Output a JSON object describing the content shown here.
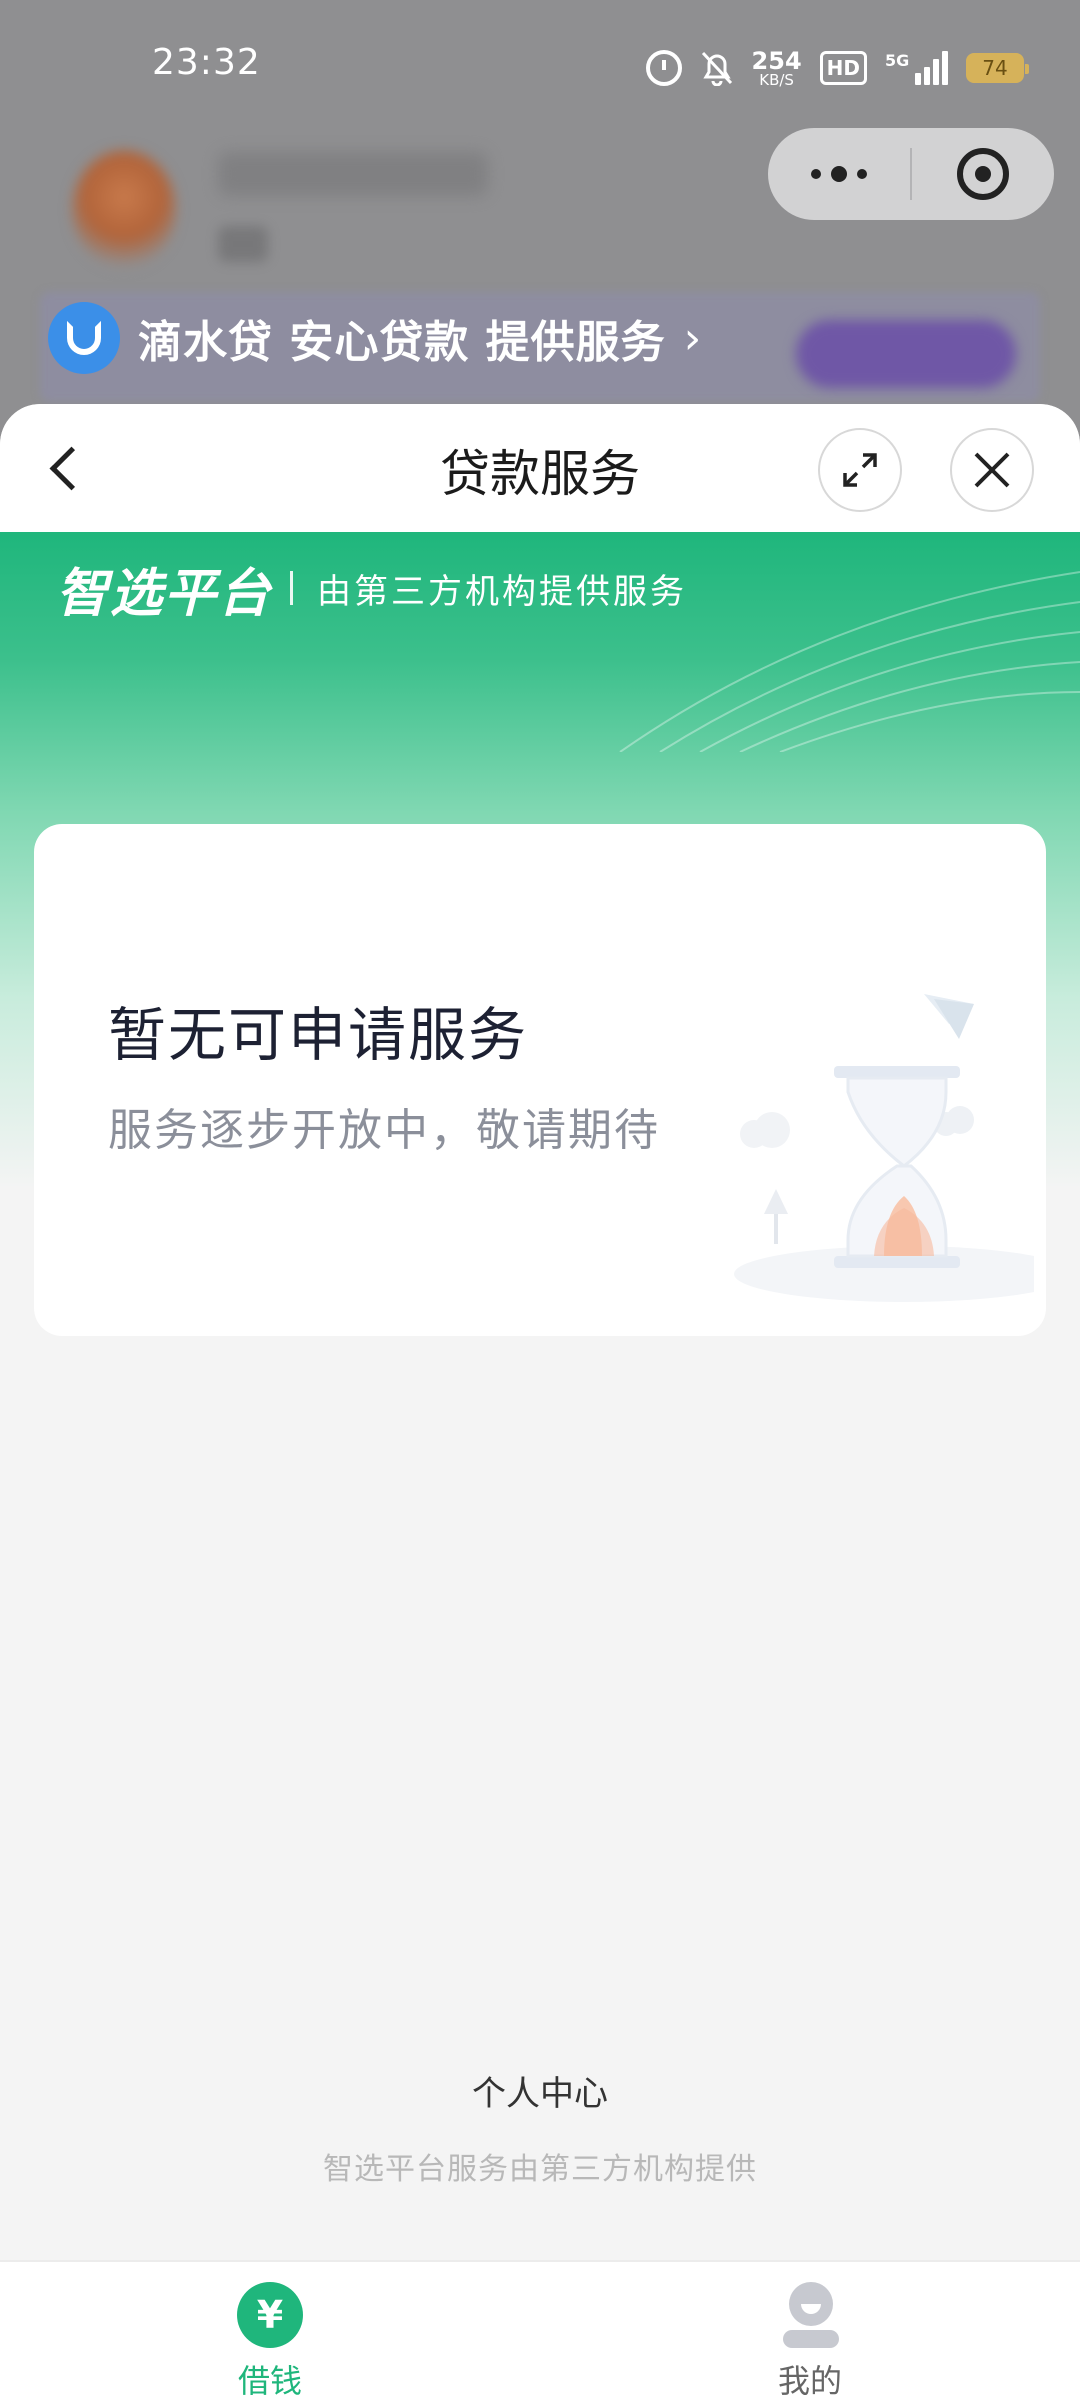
{
  "status_bar": {
    "time": "23:32",
    "net_speed_value": "254",
    "net_speed_unit": "KB/S",
    "hd_label": "HD",
    "network_type": "5G",
    "battery_level": "74",
    "icons": [
      "alarm-icon",
      "bell-muted-icon",
      "hd-icon",
      "signal-icon",
      "battery-icon"
    ]
  },
  "capsule": {
    "icons": [
      "more-icon",
      "target-close-icon"
    ]
  },
  "provider": {
    "text": "滴水贷 安心贷款 提供服务",
    "chevron": "›"
  },
  "sheet": {
    "title": "贷款服务",
    "icons": [
      "back-icon",
      "expand-icon",
      "close-icon"
    ]
  },
  "brand": {
    "title": "智选平台",
    "subtitle": "由第三方机构提供服务"
  },
  "empty_card": {
    "title": "暂无可申请服务",
    "description": "服务逐步开放中，敬请期待",
    "illustration": "hourglass-illustration"
  },
  "footer": {
    "center_link": "个人中心",
    "disclaimer": "智选平台服务由第三方机构提供"
  },
  "tabbar": {
    "items": [
      {
        "label": "借钱",
        "icon": "yen-icon",
        "active": true
      },
      {
        "label": "我的",
        "icon": "user-icon",
        "active": false
      }
    ]
  },
  "colors": {
    "accent": "#1fb67c",
    "overlay": "#8f8f91",
    "text_primary": "#1d2133",
    "text_secondary": "#8b8f9a"
  }
}
